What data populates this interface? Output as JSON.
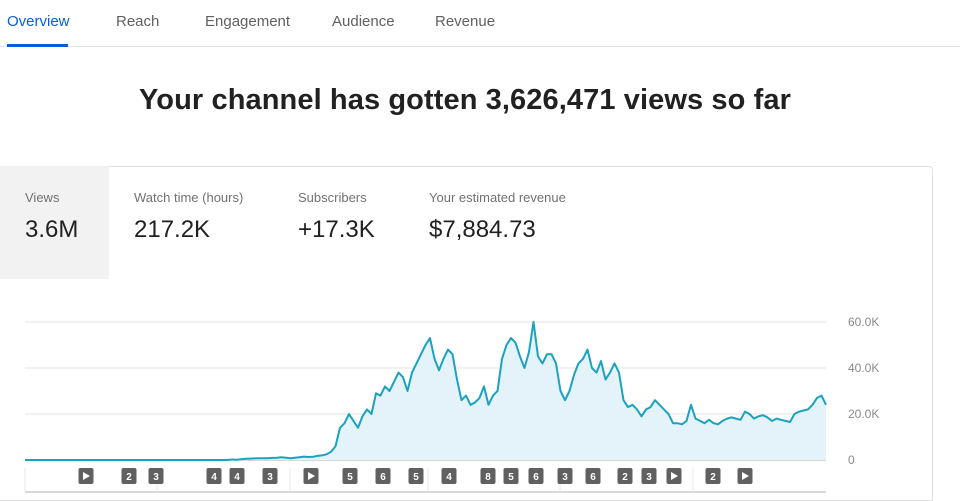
{
  "tabs": [
    {
      "label": "Overview",
      "active": true
    },
    {
      "label": "Reach",
      "active": false
    },
    {
      "label": "Engagement",
      "active": false
    },
    {
      "label": "Audience",
      "active": false
    },
    {
      "label": "Revenue",
      "active": false
    }
  ],
  "headline": "Your channel has gotten 3,626,471 views so far",
  "metrics": [
    {
      "label": "Views",
      "value": "3.6M",
      "selected": true
    },
    {
      "label": "Watch time (hours)",
      "value": "217.2K",
      "selected": false
    },
    {
      "label": "Subscribers",
      "value": "+17.3K",
      "selected": false
    },
    {
      "label": "Your estimated revenue",
      "value": "$7,884.73",
      "selected": false
    }
  ],
  "colors": {
    "accent": "#065fd4",
    "line": "#1aa2c0",
    "area": "#e3f3f9",
    "marker": "#606060"
  },
  "chart_data": {
    "type": "area",
    "ylabels": [
      "60.0K",
      "40.0K",
      "20.0K",
      "0"
    ],
    "yticks": [
      60000,
      40000,
      20000,
      0
    ],
    "ylim": [
      0,
      60000
    ],
    "grid": true,
    "values": [
      0,
      0,
      0,
      0,
      0,
      0,
      0,
      0,
      0,
      0,
      0,
      0,
      0,
      0,
      0,
      0,
      0,
      0,
      0,
      0,
      0,
      0,
      0,
      0,
      0,
      0,
      0,
      0,
      0,
      0,
      0,
      0,
      0,
      0,
      0,
      0,
      0,
      0,
      0,
      0,
      0,
      0,
      0,
      0,
      0,
      0,
      200,
      100,
      300,
      500,
      600,
      700,
      800,
      800,
      800,
      900,
      1000,
      1200,
      1000,
      800,
      1000,
      1200,
      1500,
      1300,
      1400,
      1800,
      2000,
      2500,
      3500,
      6000,
      14000,
      16000,
      20000,
      17000,
      14000,
      19000,
      22000,
      20000,
      29000,
      28000,
      32000,
      30000,
      34000,
      38000,
      36000,
      30000,
      38000,
      42000,
      46000,
      50000,
      53000,
      44000,
      39000,
      44000,
      48000,
      46000,
      35000,
      26000,
      28000,
      24000,
      25000,
      27000,
      32000,
      24000,
      28000,
      30000,
      44000,
      50000,
      53000,
      51000,
      45000,
      40000,
      47000,
      60000,
      45000,
      42000,
      46000,
      46000,
      42000,
      30000,
      26000,
      30000,
      37000,
      42000,
      44000,
      48000,
      40000,
      38000,
      43000,
      35000,
      38000,
      42000,
      38000,
      26000,
      23000,
      24000,
      22000,
      19000,
      22000,
      23000,
      26000,
      24000,
      22000,
      20000,
      16000,
      16000,
      15500,
      17000,
      24000,
      18000,
      17000,
      16000,
      17500,
      16000,
      15500,
      17000,
      18000,
      18500,
      18000,
      17500,
      21000,
      20000,
      18000,
      19000,
      19500,
      18500,
      17000,
      18000,
      17500,
      17000,
      16500,
      20000,
      21000,
      21500,
      22000,
      24000,
      27000,
      28000,
      24000
    ],
    "markers": [
      "play",
      "2",
      "3",
      "4",
      "4",
      "3",
      "play",
      "5",
      "6",
      "5",
      "4",
      "8",
      "5",
      "6",
      "3",
      "6",
      "2",
      "3",
      "play",
      "2",
      "play"
    ]
  }
}
